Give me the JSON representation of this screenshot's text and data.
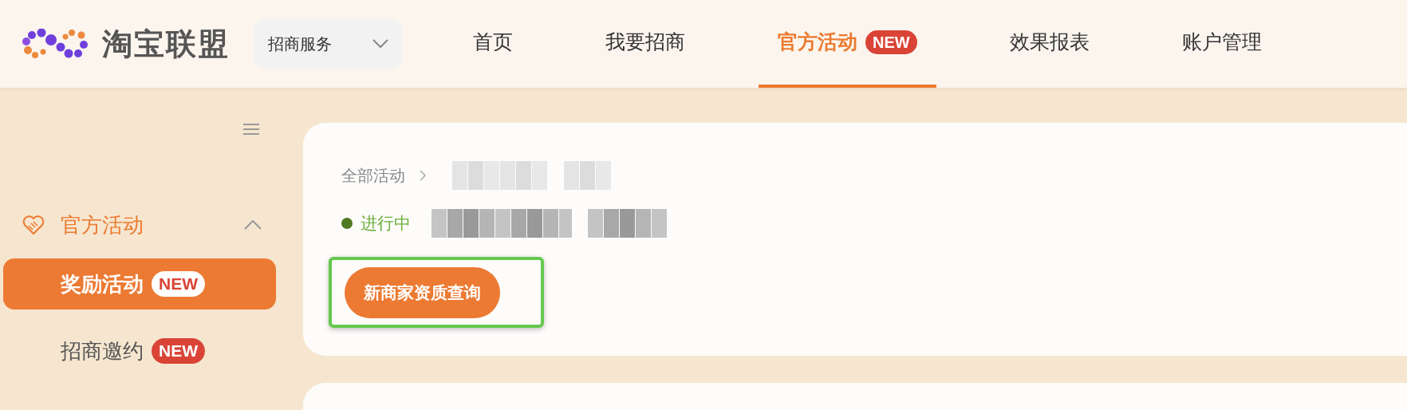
{
  "logo": {
    "text": "淘宝联盟"
  },
  "service_dropdown": {
    "label": "招商服务"
  },
  "nav": [
    {
      "label": "首页",
      "selected": false
    },
    {
      "label": "我要招商",
      "selected": false
    },
    {
      "label": "官方活动",
      "selected": true,
      "badge": "NEW"
    },
    {
      "label": "效果报表",
      "selected": false
    },
    {
      "label": "账户管理",
      "selected": false
    }
  ],
  "sidebar": {
    "group": {
      "label": "官方活动",
      "expanded": true,
      "items": [
        {
          "label": "奖励活动",
          "selected": true,
          "badge": "NEW"
        },
        {
          "label": "招商邀约",
          "selected": false,
          "badge": "NEW"
        }
      ]
    }
  },
  "activity": {
    "breadcrumb": "全部活动",
    "status": {
      "label": "进行中",
      "color": "#4f7a21"
    },
    "button": "新商家资质查询",
    "highlighted": true
  }
}
